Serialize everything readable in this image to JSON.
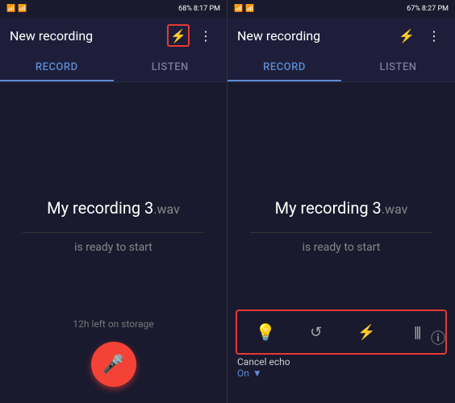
{
  "left_panel": {
    "status_bar": {
      "left": "📱",
      "network": "68%",
      "time": "8:17 PM"
    },
    "header": {
      "title": "New recording",
      "flash_icon": "⚡",
      "menu_icon": "⋮"
    },
    "tabs": [
      {
        "label": "RECORD",
        "active": true
      },
      {
        "label": "LISTEN",
        "active": false
      }
    ],
    "recording": {
      "name": "My recording 3",
      "ext": ".wav",
      "status": "is ready to start"
    },
    "storage": "12h left on storage",
    "record_button_label": "🎤"
  },
  "right_panel": {
    "status_bar": {
      "left": "📱",
      "network": "67%",
      "time": "8:27 PM"
    },
    "header": {
      "title": "New recording",
      "flash_icon": "⚡",
      "menu_icon": "⋮"
    },
    "tabs": [
      {
        "label": "RECORD",
        "active": true
      },
      {
        "label": "LISTEN",
        "active": false
      }
    ],
    "recording": {
      "name": "My recording 3",
      "ext": ".wav",
      "status": "is ready to start"
    },
    "toolbar_icons": [
      {
        "name": "lightbulb",
        "symbol": "💡",
        "color": "normal"
      },
      {
        "name": "undo",
        "symbol": "↩",
        "color": "normal"
      },
      {
        "name": "flash-off",
        "symbol": "⚡",
        "color": "blue"
      },
      {
        "name": "waveform",
        "symbol": "≋",
        "color": "normal"
      }
    ],
    "cancel_echo": {
      "label": "Cancel echo",
      "value": "On",
      "dropdown": "▼"
    },
    "info_icon": "ⓘ"
  }
}
